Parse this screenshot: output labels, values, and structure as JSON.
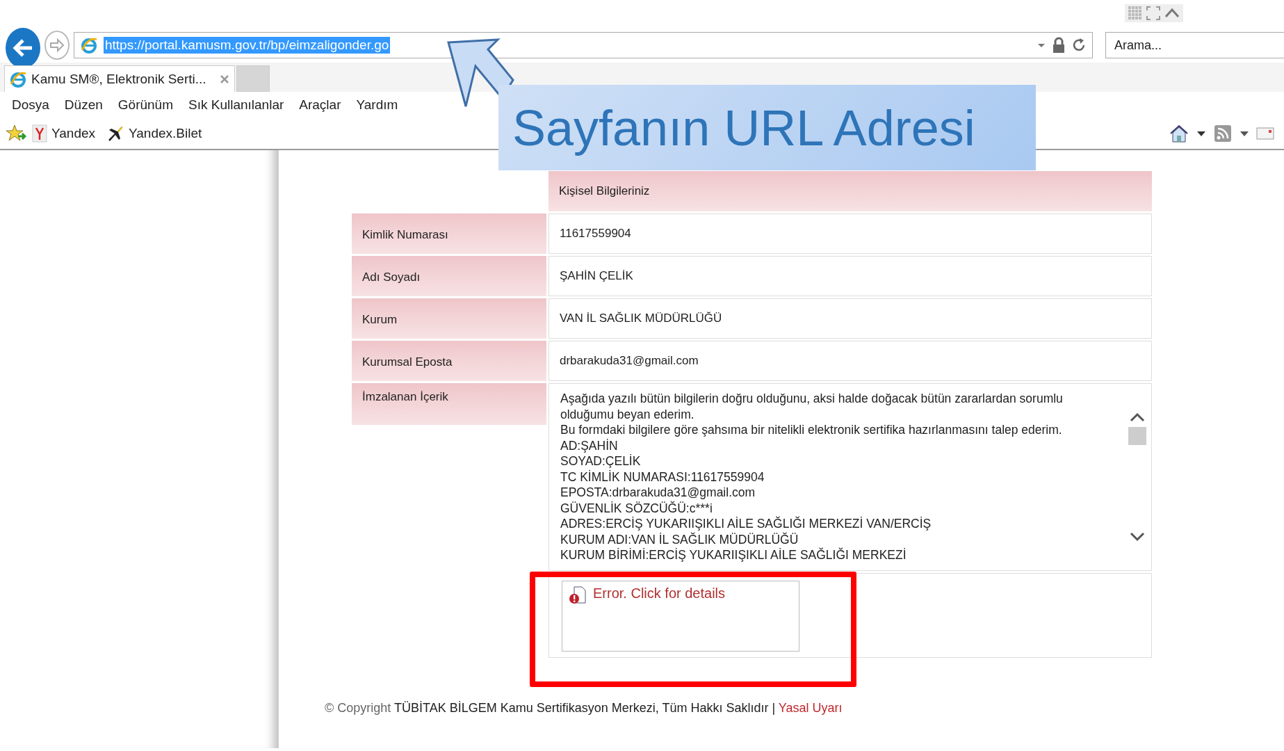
{
  "browser": {
    "address": "https://portal.kamusm.gov.tr/bp/eimzaligonder.go",
    "search_placeholder": "Arama...",
    "tabs": [
      {
        "label": "Kamu SM®, Elektronik Serti...",
        "selected": true
      }
    ],
    "menu": [
      "Dosya",
      "Düzen",
      "Görünüm",
      "Sık Kullanılanlar",
      "Araçlar",
      "Yardım"
    ],
    "favorites": [
      {
        "label": "Yandex",
        "kind": "yandex"
      },
      {
        "label": "Yandex.Bilet",
        "kind": "plane"
      }
    ]
  },
  "form": {
    "header": "Kişisel Bilgileriniz",
    "fields": [
      {
        "label": "Kimlik Numarası",
        "value": "11617559904"
      },
      {
        "label": "Adı Soyadı",
        "value": "ŞAHİN ÇELİK"
      },
      {
        "label": "Kurum",
        "value": "VAN İL SAĞLIK MÜDÜRLÜĞÜ"
      },
      {
        "label": "Kurumsal Eposta",
        "value": "drbarakuda31@gmail.com"
      }
    ],
    "content": {
      "label": "İmzalanan İçerik",
      "lines": [
        "Aşağıda yazılı bütün bilgilerin doğru olduğunu, aksi halde doğacak bütün zararlardan sorumlu olduğumu beyan ederim.",
        "Bu formdaki bilgilere göre şahsıma bir nitelikli elektronik sertifika hazırlanmasını talep ederim.",
        "AD:ŞAHİN",
        "SOYAD:ÇELİK",
        "TC KİMLİK NUMARASI:11617559904",
        "EPOSTA:drbarakuda31@gmail.com",
        "GÜVENLİK SÖZCÜĞÜ:c***i",
        "ADRES:ERCİŞ YUKARIIŞIKLI AİLE SAĞLIĞI MERKEZİ VAN/ERCİŞ",
        "KURUM ADI:VAN İL SAĞLIK MÜDÜRLÜĞÜ",
        "KURUM BİRİMİ:ERCİŞ YUKARIIŞIKLI AİLE SAĞLIĞI MERKEZİ"
      ]
    },
    "error": "Error. Click for details"
  },
  "footer": {
    "prefix": "© Copyright",
    "text": "TÜBİTAK BİLGEM Kamu Sertifikasyon Merkezi, Tüm Hakkı Saklıdır |",
    "link": "Yasal Uyarı"
  },
  "annotation": {
    "text": "Sayfanın URL Adresi"
  }
}
